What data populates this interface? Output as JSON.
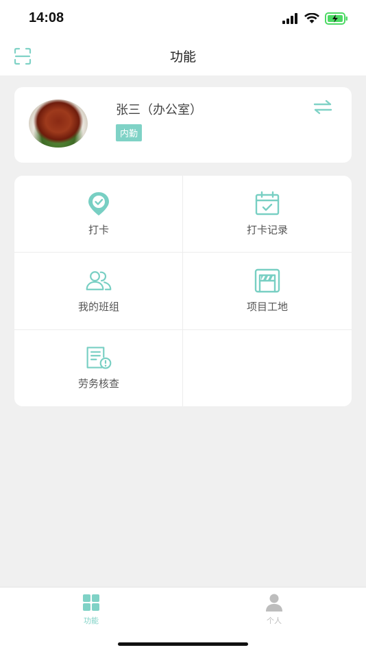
{
  "status_bar": {
    "time": "14:08"
  },
  "nav": {
    "title": "功能",
    "scan_icon": "scan-icon"
  },
  "profile": {
    "name": "张三（办公室）",
    "badge": "内勤",
    "switch_icon": "switch-icon"
  },
  "functions": [
    {
      "label": "打卡",
      "icon": "location-check-icon"
    },
    {
      "label": "打卡记录",
      "icon": "calendar-check-icon"
    },
    {
      "label": "我的班组",
      "icon": "group-icon"
    },
    {
      "label": "项目工地",
      "icon": "construction-site-icon"
    },
    {
      "label": "劳务核查",
      "icon": "document-alert-icon"
    }
  ],
  "tabs": [
    {
      "label": "功能",
      "icon": "grid-icon",
      "active": true
    },
    {
      "label": "个人",
      "icon": "person-icon",
      "active": false
    }
  ],
  "colors": {
    "accent": "#7fd2c6",
    "accent_icon": "#78cfc3",
    "inactive": "#bdbdbd",
    "background": "#f0f0f0"
  }
}
